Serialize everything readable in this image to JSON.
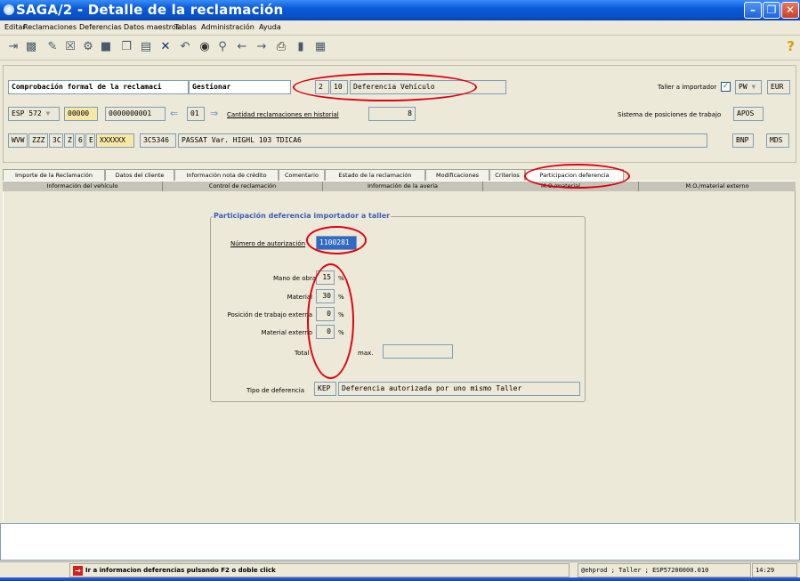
{
  "window": {
    "title": "SAGA/2 - Detalle de la reclamación"
  },
  "menu": [
    "Editar",
    "Reclamaciones",
    "Deferencias",
    "Datos maestros",
    "Tablas",
    "Administración",
    "Ayuda"
  ],
  "toolbar": {
    "help_label": "?"
  },
  "header": {
    "row1": {
      "process": "Comprobación formal de la reclamaci",
      "action": "Gestionar",
      "code_a": "2",
      "code_b": "10",
      "type_desc": "Deferencia Vehículo",
      "taller_label": "Taller a importador",
      "taller_checked": "✓",
      "brand": "PW",
      "currency": "EUR"
    },
    "row2": {
      "country": "ESP 572",
      "dealer": "00000",
      "claim_no": "0000000001",
      "seq": "01",
      "hist_label": "Cantidad reclamaciones en historial",
      "hist_value": "8",
      "sistema_label": "Sistema de posiciones de trabajo",
      "sistema_value": "APOS"
    },
    "row3": {
      "vin1": "WVW",
      "vin2": "ZZZ",
      "vin3": "3C",
      "vin4": "Z",
      "vin5": "6",
      "vin6": "E",
      "vin7": "XXXXXX",
      "model_code": "3C5346",
      "model_desc": "PASSAT Var. HIGHL 103 TDICA6",
      "btn_bnp": "BNP",
      "btn_mds": "MDS"
    }
  },
  "tabs_row1": [
    "Importe de la Reclamación",
    "Datos del cliente",
    "Información nota de crédito",
    "Comentario",
    "Estado de la reclamación",
    "Modificaciones",
    "Criterios",
    "Participacion deferencia"
  ],
  "tabs_row2": [
    "Información del vehículo",
    "Control de reclamación",
    "Información de la avería",
    "M.O./material",
    "M.O./material externo"
  ],
  "group": {
    "title": "Participación deferencia importador a taller",
    "auth_label": "Número de autorización",
    "auth_value": "1100281",
    "mano_label": "Mano de obra",
    "mano_value": "15",
    "material_label": "Material",
    "material_value": "30",
    "posicion_label": "Posición de trabajo externa",
    "posicion_value": "0",
    "matext_label": "Material externo",
    "matext_value": "0",
    "pct": "%",
    "total_label": "Total",
    "max_label": "max.",
    "max_value": "",
    "tipo_label": "Tipo de deferencia",
    "tipo_code": "KEP",
    "tipo_desc": "Deferencia autorizada por uno mismo Taller"
  },
  "status": {
    "message": "Ir a informacion deferencias pulsando F2 o doble click",
    "session": "@ehprod ; Taller ; ESP57200000.010",
    "time": "14:29"
  },
  "colors": {
    "annotation": "#e00010",
    "title_blue": "#0a5bd8",
    "group_title": "#3c5fb5"
  }
}
